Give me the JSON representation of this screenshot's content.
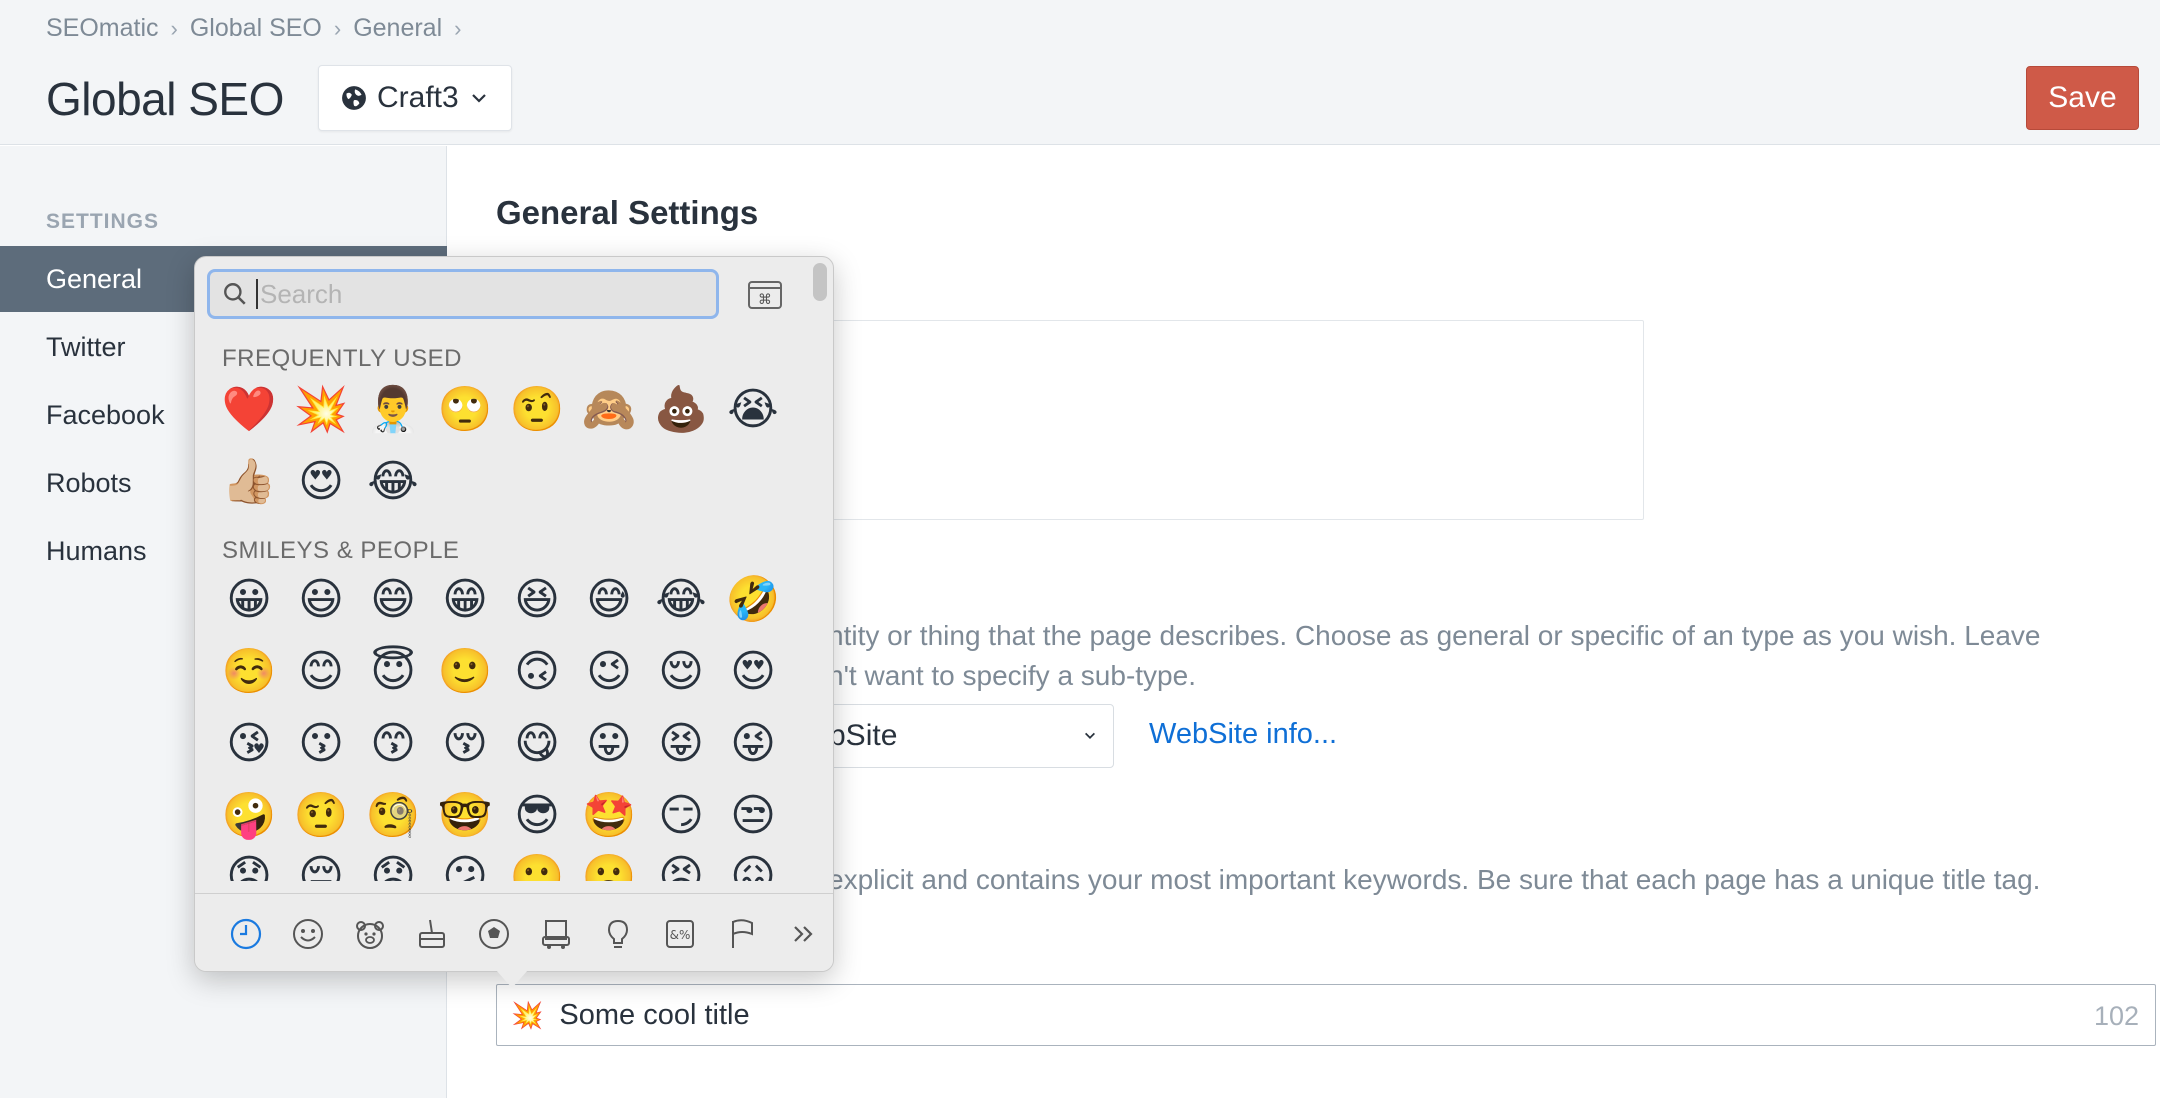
{
  "breadcrumb": [
    "SEOmatic",
    "Global SEO",
    "General"
  ],
  "breadcrumb_sep": "›",
  "page": {
    "title": "Global SEO"
  },
  "site_switcher": {
    "label": "Craft3"
  },
  "toolbar": {
    "save_label": "Save"
  },
  "sidebar": {
    "heading": "SETTINGS",
    "items": [
      {
        "label": "General",
        "active": true
      },
      {
        "label": "Twitter"
      },
      {
        "label": "Facebook"
      },
      {
        "label": "Robots"
      },
      {
        "label": "Humans"
      }
    ]
  },
  "main": {
    "section_title": "General Settings",
    "type_instructions_1": "ntity or thing that the page describes. Choose as general or specific of an type as you wish. Leave",
    "type_instructions_2": "n't want to specify a sub-type.",
    "type_select_value": "bSite",
    "type_info_link": "WebSite info...",
    "title_instructions": "explicit and contains your most important keywords. Be sure that each page has a unique title tag.",
    "title_field": {
      "emoji": "💥",
      "value": "Some cool title",
      "count": "102"
    }
  },
  "emoji_picker": {
    "search_placeholder": "Search",
    "frequently_used_label": "FREQUENTLY USED",
    "frequently_used": [
      "❤️",
      "💥",
      "👨‍⚕️",
      "🙄",
      "🤨",
      "🙈",
      "💩",
      "😭",
      "👍🏼",
      "😍",
      "😂"
    ],
    "smileys_label": "SMILEYS & PEOPLE",
    "smileys": [
      "😀",
      "😃",
      "😄",
      "😁",
      "😆",
      "😅",
      "😂",
      "🤣",
      "☺️",
      "😊",
      "😇",
      "🙂",
      "🙃",
      "😉",
      "😌",
      "😍",
      "😘",
      "😗",
      "😙",
      "😚",
      "😋",
      "😛",
      "😝",
      "😜",
      "🤪",
      "🤨",
      "🧐",
      "🤓",
      "😎",
      "🤩",
      "😏",
      "😒"
    ],
    "smileys_partial": [
      "😞",
      "😔",
      "😟",
      "😕",
      "🙁",
      "☹️",
      "😣",
      "😖"
    ],
    "categories": [
      "recent-icon",
      "smiley-icon",
      "animal-icon",
      "food-icon",
      "activity-icon",
      "travel-icon",
      "objects-icon",
      "symbols-icon",
      "flags-icon",
      "more-icon"
    ],
    "accent_color": "#1a7ae0"
  },
  "colors": {
    "save": "#cf5a48",
    "sidebar_active": "#5d6c7b",
    "link": "#0f6fd6"
  }
}
